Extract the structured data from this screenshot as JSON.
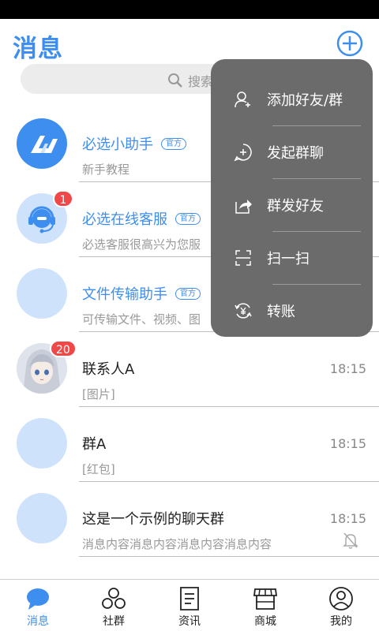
{
  "header": {
    "title": "消息"
  },
  "search": {
    "placeholder": "搜索"
  },
  "chats": [
    {
      "name": "必选小助手",
      "tag": "官方",
      "preview": "新手教程",
      "time": "",
      "badge": ""
    },
    {
      "name": "必选在线客服",
      "tag": "官方",
      "preview": "必选客服很高兴为您服",
      "time": "",
      "badge": "1"
    },
    {
      "name": "文件传输助手",
      "tag": "官方",
      "preview": "可传输文件、视频、图",
      "time": "",
      "badge": ""
    },
    {
      "name": "联系人A",
      "tag": "",
      "preview": "[图片]",
      "time": "18:15",
      "badge": "20"
    },
    {
      "name": "群A",
      "tag": "",
      "preview": "[红包]",
      "time": "18:15",
      "badge": ""
    },
    {
      "name": "这是一个示例的聊天群",
      "tag": "",
      "preview": "消息内容消息内容消息内容消息内容",
      "time": "18:15",
      "badge": ""
    }
  ],
  "popup_menu": {
    "items": [
      {
        "label": "添加好友/群",
        "icon": "add-friend-icon"
      },
      {
        "label": "发起群聊",
        "icon": "group-chat-icon"
      },
      {
        "label": "群发好友",
        "icon": "share-icon"
      },
      {
        "label": "扫一扫",
        "icon": "scan-icon"
      },
      {
        "label": "转账",
        "icon": "transfer-icon"
      }
    ]
  },
  "tabbar": {
    "tabs": [
      {
        "label": "消息",
        "icon": "chat-bubble-icon",
        "active": true
      },
      {
        "label": "社群",
        "icon": "community-icon",
        "active": false
      },
      {
        "label": "资讯",
        "icon": "news-icon",
        "active": false
      },
      {
        "label": "商城",
        "icon": "store-icon",
        "active": false
      },
      {
        "label": "我的",
        "icon": "profile-icon",
        "active": false
      }
    ]
  },
  "colors": {
    "accent": "#3e8ef0",
    "badge": "#f04848",
    "popup_bg": "#6b6b6b",
    "avatar_placeholder": "#cfe2fc"
  }
}
